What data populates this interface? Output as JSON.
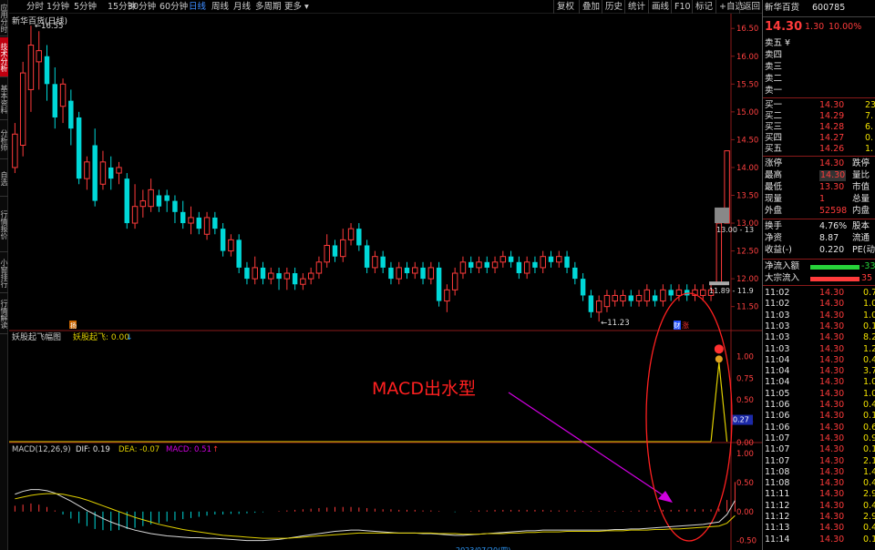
{
  "left_tabs": [
    {
      "label": "应用分时",
      "active": false
    },
    {
      "label": "技术分析",
      "active": true
    },
    {
      "label": "基本资料",
      "active": false
    },
    {
      "label": "分析师",
      "active": false
    },
    {
      "label": "自选",
      "active": false
    },
    {
      "label": "行情报价",
      "active": false
    },
    {
      "label": "小窗排行",
      "active": false
    },
    {
      "label": "行情解读",
      "active": false
    }
  ],
  "toolbar": {
    "periods": [
      "分时",
      "1分钟",
      "5分钟",
      "15分钟",
      "30分钟",
      "60分钟",
      "日线",
      "周线",
      "月线",
      "多周期",
      "更多 ▾"
    ],
    "active_period": "日线",
    "right_buttons": [
      "复权",
      "叠加",
      "历史",
      "统计",
      "画线",
      "F10",
      "标记",
      "+自选",
      "返回"
    ],
    "close_icon": "×"
  },
  "main_chart": {
    "title": "新华百货(日线)",
    "badge_left": "扬",
    "high_label": "16.55",
    "low_label": "11.23",
    "hline_label_upper": "13.00 - 13",
    "hline_label_lower": "11.89 - 11.9",
    "yaxis_ticks": [
      "16.50",
      "16.00",
      "15.50",
      "15.00",
      "14.50",
      "14.00",
      "13.50",
      "13.00",
      "12.50",
      "12.00",
      "11.50"
    ],
    "bottom_badge": "财",
    "bottom_badge2": "涨",
    "annotation": "MACD出水型"
  },
  "indicator1": {
    "name": "妖股起飞幅图",
    "sub_name": "妖股起飞: 0.00",
    "arrow": "↓",
    "yaxis_ticks": [
      "1.00",
      "0.75",
      "0.50",
      "0.25",
      "0.00"
    ],
    "current_value": "0.27"
  },
  "macd": {
    "label": "MACD(12,26,9)",
    "dif": "DIF: 0.19",
    "dea": "DEA: -0.07",
    "macd": "MACD: 0.51",
    "arrow": "↑",
    "yaxis_ticks": [
      "1.00",
      "0.50",
      "0.00",
      "-0.50"
    ],
    "date_label": "2023/07/20(四)"
  },
  "colors": {
    "up": "#ff3b3b",
    "down": "#00d8d8",
    "dif": "#d8d8d8",
    "dea": "#e0d000",
    "annotation": "#ff2020",
    "arrow": "#d000e0",
    "ellipse": "#ff2020"
  },
  "chart_data": {
    "type": "candlestick",
    "title": "新华百货(日线)",
    "ylim": [
      11.2,
      16.7
    ],
    "candles": [
      {
        "o": 14.0,
        "c": 14.6,
        "h": 14.8,
        "l": 13.9
      },
      {
        "o": 14.4,
        "c": 15.7,
        "h": 15.9,
        "l": 14.2
      },
      {
        "o": 15.4,
        "c": 16.2,
        "h": 16.55,
        "l": 15.0
      },
      {
        "o": 15.9,
        "c": 16.1,
        "h": 16.45,
        "l": 15.4
      },
      {
        "o": 16.0,
        "c": 15.5,
        "h": 16.2,
        "l": 15.2
      },
      {
        "o": 15.5,
        "c": 14.9,
        "h": 15.8,
        "l": 14.7
      },
      {
        "o": 15.1,
        "c": 15.5,
        "h": 15.6,
        "l": 14.8
      },
      {
        "o": 15.2,
        "c": 14.7,
        "h": 15.4,
        "l": 14.4
      },
      {
        "o": 14.9,
        "c": 13.8,
        "h": 15.0,
        "l": 13.7
      },
      {
        "o": 13.8,
        "c": 14.1,
        "h": 14.2,
        "l": 13.6
      },
      {
        "o": 14.4,
        "c": 13.4,
        "h": 14.7,
        "l": 13.3
      },
      {
        "o": 13.7,
        "c": 14.1,
        "h": 14.3,
        "l": 13.6
      },
      {
        "o": 14.0,
        "c": 13.8,
        "h": 14.2,
        "l": 13.6
      },
      {
        "o": 13.9,
        "c": 14.0,
        "h": 14.1,
        "l": 13.7
      },
      {
        "o": 13.8,
        "c": 13.0,
        "h": 13.9,
        "l": 12.9
      },
      {
        "o": 13.0,
        "c": 13.3,
        "h": 13.7,
        "l": 12.9
      },
      {
        "o": 13.3,
        "c": 13.4,
        "h": 13.6,
        "l": 13.1
      },
      {
        "o": 13.3,
        "c": 13.6,
        "h": 13.8,
        "l": 13.2
      },
      {
        "o": 13.5,
        "c": 13.3,
        "h": 13.6,
        "l": 13.2
      },
      {
        "o": 13.5,
        "c": 13.4,
        "h": 13.6,
        "l": 13.2
      },
      {
        "o": 13.4,
        "c": 13.2,
        "h": 13.5,
        "l": 13.0
      },
      {
        "o": 13.2,
        "c": 13.0,
        "h": 13.4,
        "l": 12.9
      },
      {
        "o": 13.0,
        "c": 13.1,
        "h": 13.3,
        "l": 12.8
      },
      {
        "o": 13.1,
        "c": 12.9,
        "h": 13.2,
        "l": 12.8
      },
      {
        "o": 12.8,
        "c": 13.1,
        "h": 13.2,
        "l": 12.7
      },
      {
        "o": 13.1,
        "c": 12.9,
        "h": 13.2,
        "l": 12.8
      },
      {
        "o": 12.9,
        "c": 12.5,
        "h": 13.0,
        "l": 12.4
      },
      {
        "o": 12.5,
        "c": 12.7,
        "h": 12.8,
        "l": 12.4
      },
      {
        "o": 12.7,
        "c": 12.2,
        "h": 12.8,
        "l": 12.1
      },
      {
        "o": 12.2,
        "c": 12.0,
        "h": 12.3,
        "l": 11.9
      },
      {
        "o": 12.0,
        "c": 12.2,
        "h": 12.4,
        "l": 11.9
      },
      {
        "o": 12.2,
        "c": 12.0,
        "h": 12.3,
        "l": 11.9
      },
      {
        "o": 12.0,
        "c": 12.1,
        "h": 12.2,
        "l": 11.9
      },
      {
        "o": 12.1,
        "c": 12.0,
        "h": 12.2,
        "l": 11.8
      },
      {
        "o": 12.0,
        "c": 12.1,
        "h": 12.2,
        "l": 11.8
      },
      {
        "o": 12.1,
        "c": 11.9,
        "h": 12.2,
        "l": 11.8
      },
      {
        "o": 11.9,
        "c": 12.0,
        "h": 12.1,
        "l": 11.8
      },
      {
        "o": 12.0,
        "c": 12.1,
        "h": 12.2,
        "l": 11.9
      },
      {
        "o": 12.1,
        "c": 12.3,
        "h": 12.4,
        "l": 12.0
      },
      {
        "o": 12.3,
        "c": 12.6,
        "h": 12.8,
        "l": 12.2
      },
      {
        "o": 12.6,
        "c": 12.4,
        "h": 12.7,
        "l": 12.3
      },
      {
        "o": 12.4,
        "c": 12.7,
        "h": 12.9,
        "l": 12.3
      },
      {
        "o": 12.7,
        "c": 12.9,
        "h": 13.0,
        "l": 12.6
      },
      {
        "o": 12.9,
        "c": 12.6,
        "h": 13.0,
        "l": 12.5
      },
      {
        "o": 12.6,
        "c": 12.2,
        "h": 12.7,
        "l": 12.1
      },
      {
        "o": 12.2,
        "c": 12.4,
        "h": 12.5,
        "l": 12.1
      },
      {
        "o": 12.4,
        "c": 12.2,
        "h": 12.5,
        "l": 12.1
      },
      {
        "o": 12.2,
        "c": 12.0,
        "h": 12.3,
        "l": 11.9
      },
      {
        "o": 12.0,
        "c": 12.2,
        "h": 12.3,
        "l": 11.9
      },
      {
        "o": 12.2,
        "c": 12.1,
        "h": 12.3,
        "l": 12.0
      },
      {
        "o": 12.1,
        "c": 12.2,
        "h": 12.3,
        "l": 12.0
      },
      {
        "o": 12.2,
        "c": 12.0,
        "h": 12.3,
        "l": 11.9
      },
      {
        "o": 12.0,
        "c": 12.2,
        "h": 12.3,
        "l": 11.9
      },
      {
        "o": 12.2,
        "c": 11.6,
        "h": 12.3,
        "l": 11.5
      },
      {
        "o": 11.6,
        "c": 11.8,
        "h": 11.9,
        "l": 11.4
      },
      {
        "o": 11.8,
        "c": 12.1,
        "h": 12.2,
        "l": 11.7
      },
      {
        "o": 12.1,
        "c": 12.3,
        "h": 12.4,
        "l": 12.0
      },
      {
        "o": 12.3,
        "c": 12.2,
        "h": 12.4,
        "l": 12.1
      },
      {
        "o": 12.2,
        "c": 12.3,
        "h": 12.4,
        "l": 12.1
      },
      {
        "o": 12.3,
        "c": 12.2,
        "h": 12.4,
        "l": 12.1
      },
      {
        "o": 12.2,
        "c": 12.3,
        "h": 12.4,
        "l": 12.1
      },
      {
        "o": 12.3,
        "c": 12.4,
        "h": 12.5,
        "l": 12.2
      },
      {
        "o": 12.4,
        "c": 12.3,
        "h": 12.5,
        "l": 12.2
      },
      {
        "o": 12.3,
        "c": 12.1,
        "h": 12.4,
        "l": 12.0
      },
      {
        "o": 12.1,
        "c": 12.3,
        "h": 12.4,
        "l": 12.0
      },
      {
        "o": 12.3,
        "c": 12.2,
        "h": 12.4,
        "l": 12.1
      },
      {
        "o": 12.2,
        "c": 12.4,
        "h": 12.5,
        "l": 12.1
      },
      {
        "o": 12.4,
        "c": 12.3,
        "h": 12.5,
        "l": 12.2
      },
      {
        "o": 12.3,
        "c": 12.4,
        "h": 12.5,
        "l": 12.2
      },
      {
        "o": 12.4,
        "c": 12.2,
        "h": 12.5,
        "l": 12.1
      },
      {
        "o": 12.2,
        "c": 12.0,
        "h": 12.3,
        "l": 11.9
      },
      {
        "o": 12.0,
        "c": 11.7,
        "h": 12.1,
        "l": 11.6
      },
      {
        "o": 11.7,
        "c": 11.4,
        "h": 11.8,
        "l": 11.3
      },
      {
        "o": 11.4,
        "c": 11.6,
        "h": 11.7,
        "l": 11.23
      },
      {
        "o": 11.5,
        "c": 11.7,
        "h": 11.8,
        "l": 11.4
      },
      {
        "o": 11.6,
        "c": 11.7,
        "h": 11.8,
        "l": 11.5
      },
      {
        "o": 11.6,
        "c": 11.7,
        "h": 11.8,
        "l": 11.5
      },
      {
        "o": 11.7,
        "c": 11.6,
        "h": 11.8,
        "l": 11.5
      },
      {
        "o": 11.6,
        "c": 11.7,
        "h": 11.8,
        "l": 11.5
      },
      {
        "o": 11.6,
        "c": 11.8,
        "h": 11.9,
        "l": 11.5
      },
      {
        "o": 11.7,
        "c": 11.6,
        "h": 11.8,
        "l": 11.5
      },
      {
        "o": 11.6,
        "c": 11.8,
        "h": 11.9,
        "l": 11.5
      },
      {
        "o": 11.8,
        "c": 11.7,
        "h": 11.9,
        "l": 11.6
      },
      {
        "o": 11.7,
        "c": 11.8,
        "h": 11.9,
        "l": 11.6
      },
      {
        "o": 11.8,
        "c": 11.7,
        "h": 11.9,
        "l": 11.6
      },
      {
        "o": 11.7,
        "c": 11.8,
        "h": 11.9,
        "l": 11.6
      },
      {
        "o": 11.7,
        "c": 11.8,
        "h": 11.9,
        "l": 11.6
      },
      {
        "o": 11.7,
        "c": 11.8,
        "h": 11.9,
        "l": 11.6
      },
      {
        "o": 11.9,
        "c": 13.0,
        "h": 13.0,
        "l": 11.9
      },
      {
        "o": 13.0,
        "c": 14.3,
        "h": 14.3,
        "l": 13.0
      }
    ],
    "indicator1_values": [
      0,
      0,
      0,
      0,
      0,
      0,
      0,
      0,
      0,
      0,
      0,
      0,
      0,
      0,
      0,
      0,
      0,
      0,
      0,
      0,
      0,
      0,
      0,
      0,
      0,
      0,
      0,
      0,
      0,
      0,
      0,
      0,
      0,
      0,
      0,
      0,
      0,
      0,
      0,
      0,
      0,
      0,
      0,
      0,
      0,
      0,
      0,
      0,
      0,
      0,
      0,
      0,
      0,
      0,
      0,
      0,
      0,
      0,
      0,
      0,
      0,
      0,
      0,
      0,
      0,
      0,
      0,
      0,
      0,
      0,
      0,
      0,
      0,
      0,
      0,
      0,
      0,
      0,
      0,
      0,
      0,
      0,
      0,
      0,
      0,
      0,
      0,
      0,
      0,
      0,
      0
    ],
    "macd_histogram": [
      0.1,
      0.12,
      0.14,
      0.12,
      0.08,
      0.02,
      -0.05,
      -0.12,
      -0.2,
      -0.25,
      -0.3,
      -0.32,
      -0.33,
      -0.32,
      -0.3,
      -0.28,
      -0.25,
      -0.22,
      -0.2,
      -0.17,
      -0.15,
      -0.13,
      -0.11,
      -0.09,
      -0.07,
      -0.05,
      -0.05,
      -0.04,
      -0.04,
      -0.03,
      -0.02,
      -0.01,
      0,
      0.01,
      0.02,
      0.03,
      0.04,
      0.05,
      0.06,
      0.07,
      0.08,
      0.08,
      0.08,
      0.07,
      0.06,
      0.05,
      0.04,
      0.04,
      0.03,
      0.03,
      0.03,
      0.02,
      0.02,
      0.01,
      0,
      -0.01,
      0,
      0.01,
      0.02,
      0.02,
      0.03,
      0.03,
      0.03,
      0.03,
      0.03,
      0.03,
      0.03,
      0.02,
      0.02,
      0.02,
      0.02,
      0.01,
      0.01,
      0.01,
      0.01,
      0.01,
      0.01,
      0.01,
      0.02,
      0.02,
      0.02,
      0.03,
      0.03,
      0.03,
      0.04,
      0.04,
      0.04,
      0.04,
      0.05,
      0.2,
      0.51
    ],
    "dif": [
      0.3,
      0.35,
      0.38,
      0.38,
      0.36,
      0.32,
      0.25,
      0.18,
      0.1,
      0.02,
      -0.05,
      -0.12,
      -0.18,
      -0.23,
      -0.28,
      -0.32,
      -0.35,
      -0.38,
      -0.4,
      -0.42,
      -0.43,
      -0.44,
      -0.45,
      -0.45,
      -0.46,
      -0.46,
      -0.47,
      -0.48,
      -0.49,
      -0.5,
      -0.5,
      -0.5,
      -0.49,
      -0.48,
      -0.46,
      -0.44,
      -0.42,
      -0.4,
      -0.38,
      -0.36,
      -0.34,
      -0.33,
      -0.32,
      -0.32,
      -0.33,
      -0.34,
      -0.35,
      -0.36,
      -0.37,
      -0.37,
      -0.37,
      -0.38,
      -0.38,
      -0.39,
      -0.4,
      -0.41,
      -0.41,
      -0.4,
      -0.39,
      -0.38,
      -0.37,
      -0.36,
      -0.35,
      -0.34,
      -0.33,
      -0.33,
      -0.32,
      -0.32,
      -0.32,
      -0.32,
      -0.32,
      -0.32,
      -0.32,
      -0.32,
      -0.32,
      -0.31,
      -0.31,
      -0.3,
      -0.3,
      -0.29,
      -0.28,
      -0.27,
      -0.26,
      -0.25,
      -0.24,
      -0.23,
      -0.22,
      -0.2,
      -0.18,
      -0.05,
      0.19
    ],
    "dea": [
      0.22,
      0.25,
      0.28,
      0.3,
      0.31,
      0.31,
      0.3,
      0.27,
      0.24,
      0.2,
      0.15,
      0.1,
      0.05,
      0,
      -0.05,
      -0.1,
      -0.14,
      -0.18,
      -0.22,
      -0.25,
      -0.28,
      -0.31,
      -0.33,
      -0.35,
      -0.37,
      -0.39,
      -0.41,
      -0.42,
      -0.43,
      -0.44,
      -0.45,
      -0.46,
      -0.46,
      -0.46,
      -0.46,
      -0.45,
      -0.44,
      -0.43,
      -0.42,
      -0.41,
      -0.4,
      -0.39,
      -0.38,
      -0.37,
      -0.37,
      -0.37,
      -0.37,
      -0.37,
      -0.37,
      -0.37,
      -0.37,
      -0.37,
      -0.37,
      -0.38,
      -0.38,
      -0.38,
      -0.39,
      -0.39,
      -0.39,
      -0.38,
      -0.38,
      -0.38,
      -0.37,
      -0.37,
      -0.36,
      -0.36,
      -0.35,
      -0.35,
      -0.35,
      -0.34,
      -0.34,
      -0.34,
      -0.34,
      -0.34,
      -0.33,
      -0.33,
      -0.33,
      -0.32,
      -0.32,
      -0.32,
      -0.31,
      -0.31,
      -0.3,
      -0.3,
      -0.29,
      -0.28,
      -0.27,
      -0.26,
      -0.25,
      -0.2,
      -0.07
    ]
  },
  "quote": {
    "stock_name": "新华百货",
    "stock_code": "600785",
    "price": "14.30",
    "change": "1.30",
    "change_pct": "10.00%",
    "sell_labels": [
      "卖五 ¥",
      "卖四",
      "卖三",
      "卖二",
      "卖一"
    ],
    "buy_rows": [
      {
        "label": "买一",
        "price": "14.30",
        "vol": "232"
      },
      {
        "label": "买二",
        "price": "14.29",
        "vol": "7."
      },
      {
        "label": "买三",
        "price": "14.28",
        "vol": "6."
      },
      {
        "label": "买四",
        "price": "14.27",
        "vol": "0."
      },
      {
        "label": "买五",
        "price": "14.26",
        "vol": "1."
      }
    ],
    "stats": [
      {
        "l1": "涨停",
        "v1": "14.30",
        "l2": "跌停",
        "c1": "red"
      },
      {
        "l1": "最高",
        "v1": "14.30",
        "l2": "量比",
        "c1": "red",
        "boxed": true
      },
      {
        "l1": "最低",
        "v1": "13.30",
        "l2": "市值",
        "c1": "red"
      },
      {
        "l1": "现量",
        "v1": "1",
        "l2": "总量",
        "c1": "red"
      },
      {
        "l1": "外盘",
        "v1": "52598",
        "l2": "内盘",
        "c1": "red"
      }
    ],
    "stats2": [
      {
        "l1": "换手",
        "v1": "4.76%",
        "l2": "股本"
      },
      {
        "l1": "净资",
        "v1": "8.87",
        "l2": "流通"
      },
      {
        "l1": "收益(-)",
        "v1": "0.220",
        "l2": "PE(动)"
      }
    ],
    "flows": [
      {
        "label": "净流入额",
        "value": "-33",
        "color": "#27d33a"
      },
      {
        "label": "大宗流入",
        "value": "35",
        "color": "#ff3b3b"
      }
    ],
    "ticks": [
      {
        "t": "11:02",
        "p": "14.30",
        "v": "0.7"
      },
      {
        "t": "11:02",
        "p": "14.30",
        "v": "1.0"
      },
      {
        "t": "11:03",
        "p": "14.30",
        "v": "1.0"
      },
      {
        "t": "11:03",
        "p": "14.30",
        "v": "0.1"
      },
      {
        "t": "11:03",
        "p": "14.30",
        "v": "8.2"
      },
      {
        "t": "11:03",
        "p": "14.30",
        "v": "1.2"
      },
      {
        "t": "11:04",
        "p": "14.30",
        "v": "0.4"
      },
      {
        "t": "11:04",
        "p": "14.30",
        "v": "3.7"
      },
      {
        "t": "11:04",
        "p": "14.30",
        "v": "1.0"
      },
      {
        "t": "11:05",
        "p": "14.30",
        "v": "1.0"
      },
      {
        "t": "11:06",
        "p": "14.30",
        "v": "0.4"
      },
      {
        "t": "11:06",
        "p": "14.30",
        "v": "0.1"
      },
      {
        "t": "11:06",
        "p": "14.30",
        "v": "0.6"
      },
      {
        "t": "11:07",
        "p": "14.30",
        "v": "0.9"
      },
      {
        "t": "11:07",
        "p": "14.30",
        "v": "0.1"
      },
      {
        "t": "11:07",
        "p": "14.30",
        "v": "2.1"
      },
      {
        "t": "11:08",
        "p": "14.30",
        "v": "1.4"
      },
      {
        "t": "11:08",
        "p": "14.30",
        "v": "0.4"
      },
      {
        "t": "11:11",
        "p": "14.30",
        "v": "2.9"
      },
      {
        "t": "11:12",
        "p": "14.30",
        "v": "0.4"
      },
      {
        "t": "11:12",
        "p": "14.30",
        "v": "2.9"
      },
      {
        "t": "11:13",
        "p": "14.30",
        "v": "0.4"
      },
      {
        "t": "11:14",
        "p": "14.30",
        "v": "0.1"
      }
    ]
  }
}
